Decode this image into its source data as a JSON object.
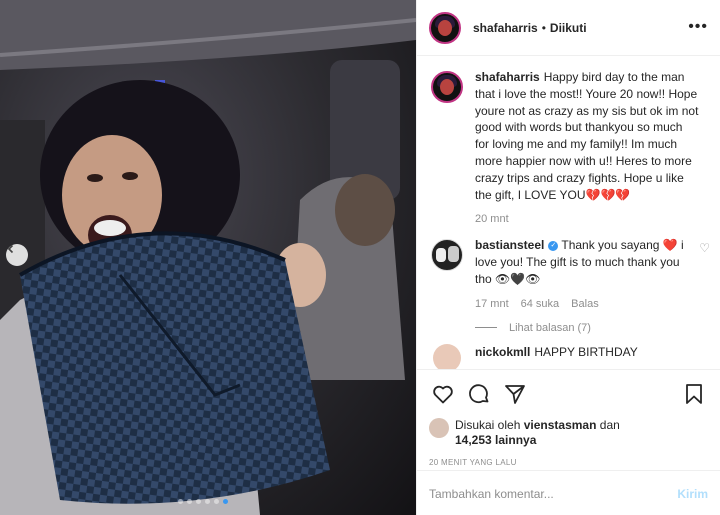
{
  "post": {
    "author": "shafaharris",
    "separator": "•",
    "follow_status": "Diikuti",
    "more_icon": "more-horizontal-icon"
  },
  "caption": {
    "username": "shafaharris",
    "text": "Happy bird day to the man that i love the most!! Youre 20 now!! Hope youre not as crazy as my sis but ok im not good with words but thankyou so much for loving me and my family!! Im much more happier now with u!! Heres to more crazy trips and crazy fights. Hope u like the gift, I LOVE YOU💔💔💔",
    "time": "20 mnt"
  },
  "comment1": {
    "username": "bastiansteel",
    "verified_icon": "verified-badge-icon",
    "text": "Thank you sayang ❤️ i love you! The gift is to much thank you tho 👁🖤👁",
    "time": "17 mnt",
    "likes": "64 suka",
    "reply": "Balas",
    "view_replies": "Lihat balasan (7)"
  },
  "comment2": {
    "username": "nickokmll",
    "text": "HAPPY BIRTHDAY"
  },
  "likes": {
    "prefix": "Disukai oleh",
    "user": "vienstasman",
    "middle": "dan",
    "count": "14,253 lainnya"
  },
  "timestamp": "20 MENIT YANG LALU",
  "add_comment": {
    "placeholder": "Tambahkan komentar...",
    "send_label": "Kirim"
  },
  "carousel": {
    "total_dots": 6,
    "active_index": 5
  },
  "colors": {
    "accent": "#3897f0",
    "send_disabled": "#b2dffc",
    "muted": "#8e8e8e",
    "text": "#262626"
  }
}
